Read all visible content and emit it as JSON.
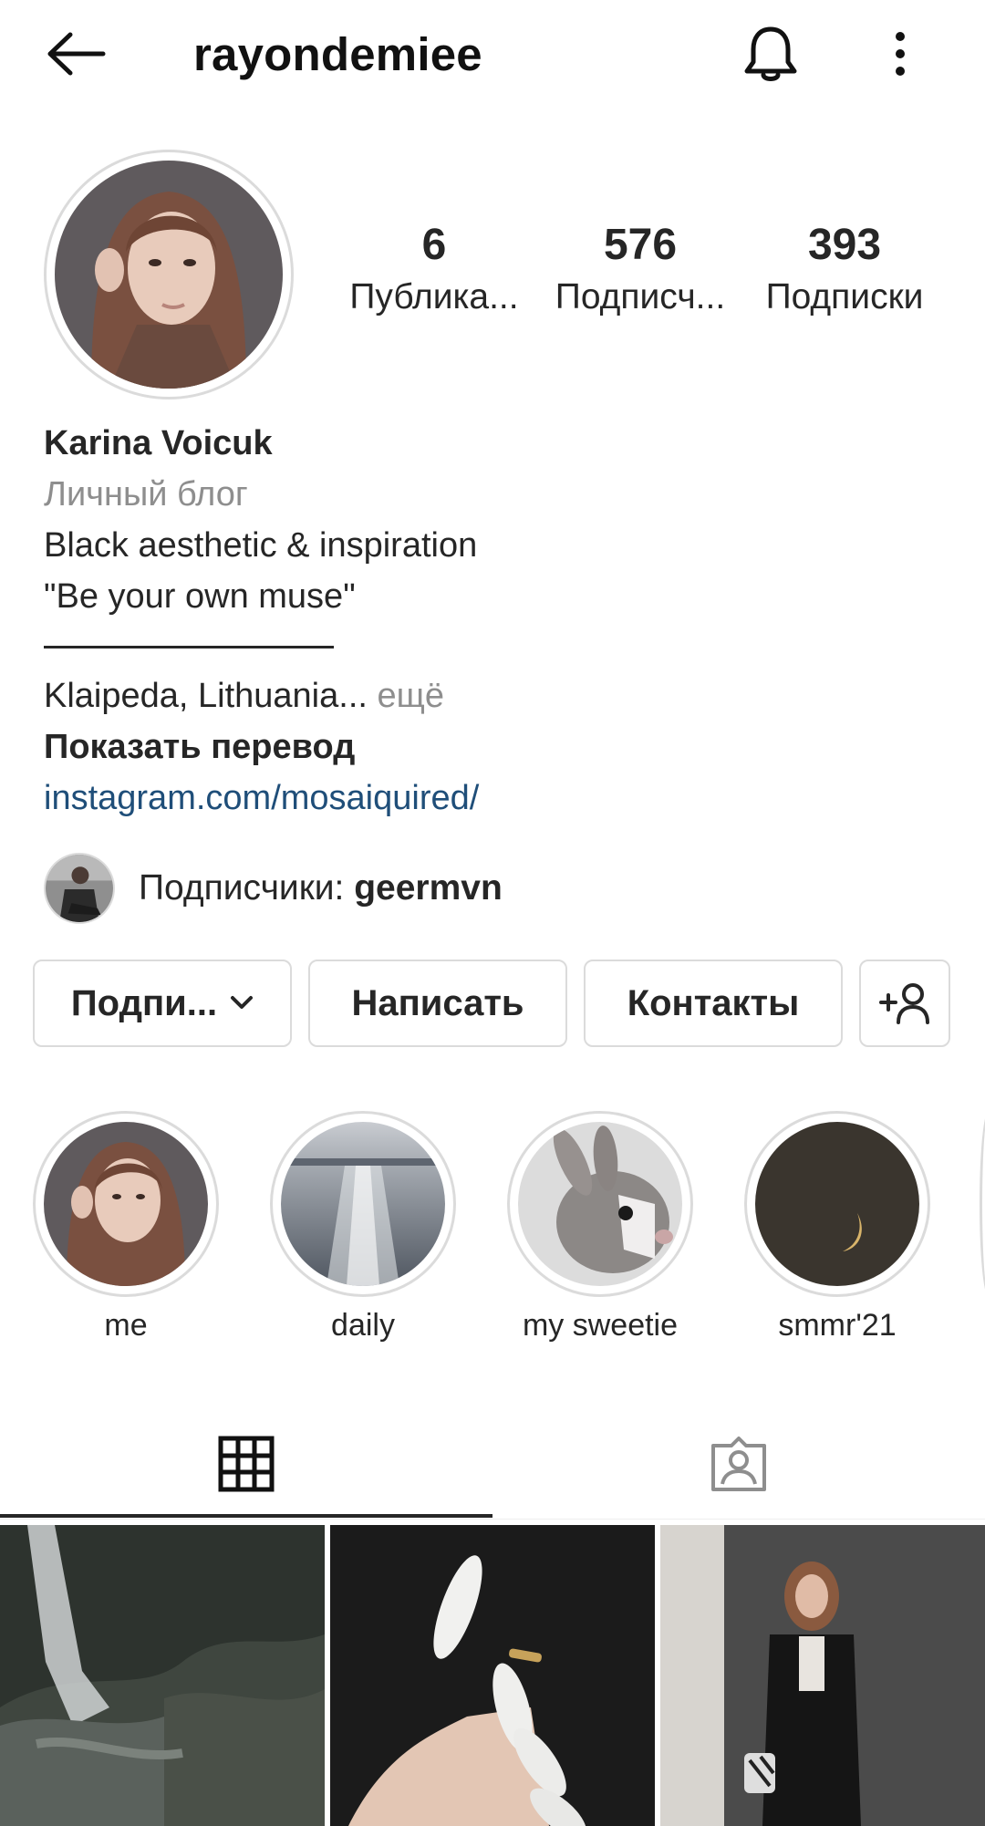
{
  "header": {
    "username": "rayondemiee"
  },
  "stats": {
    "posts": {
      "value": "6",
      "label": "Публика..."
    },
    "followers": {
      "value": "576",
      "label": "Подписч..."
    },
    "following": {
      "value": "393",
      "label": "Подписки"
    }
  },
  "bio": {
    "name": "Karina Voicuk",
    "category": "Личный блог",
    "line1": "Black aesthetic & inspiration",
    "line2": "\"Be your own muse\"",
    "location": "Klaipeda, Lithuania...",
    "more": " ещё",
    "translate": "Показать перевод",
    "link": "instagram.com/mosaiquired/"
  },
  "followed_by": {
    "prefix": "Подписчики: ",
    "username": "geermvn"
  },
  "actions": {
    "subscribed": "Подпи...",
    "message": "Написать",
    "contacts": "Контакты"
  },
  "highlights": [
    {
      "label": "me"
    },
    {
      "label": "daily"
    },
    {
      "label": "my sweetie"
    },
    {
      "label": "smmr'21"
    }
  ],
  "icons": {
    "back": "arrow-left-icon",
    "notifications": "bell-icon",
    "more": "more-vertical-icon",
    "dropdown": "chevron-down-icon",
    "add_user": "add-person-icon",
    "grid_tab": "grid-icon",
    "tagged_tab": "tagged-person-icon"
  },
  "colors": {
    "link": "#1f4e79",
    "muted": "#8e8e8e",
    "text": "#262626",
    "border": "#dbdbdb"
  }
}
